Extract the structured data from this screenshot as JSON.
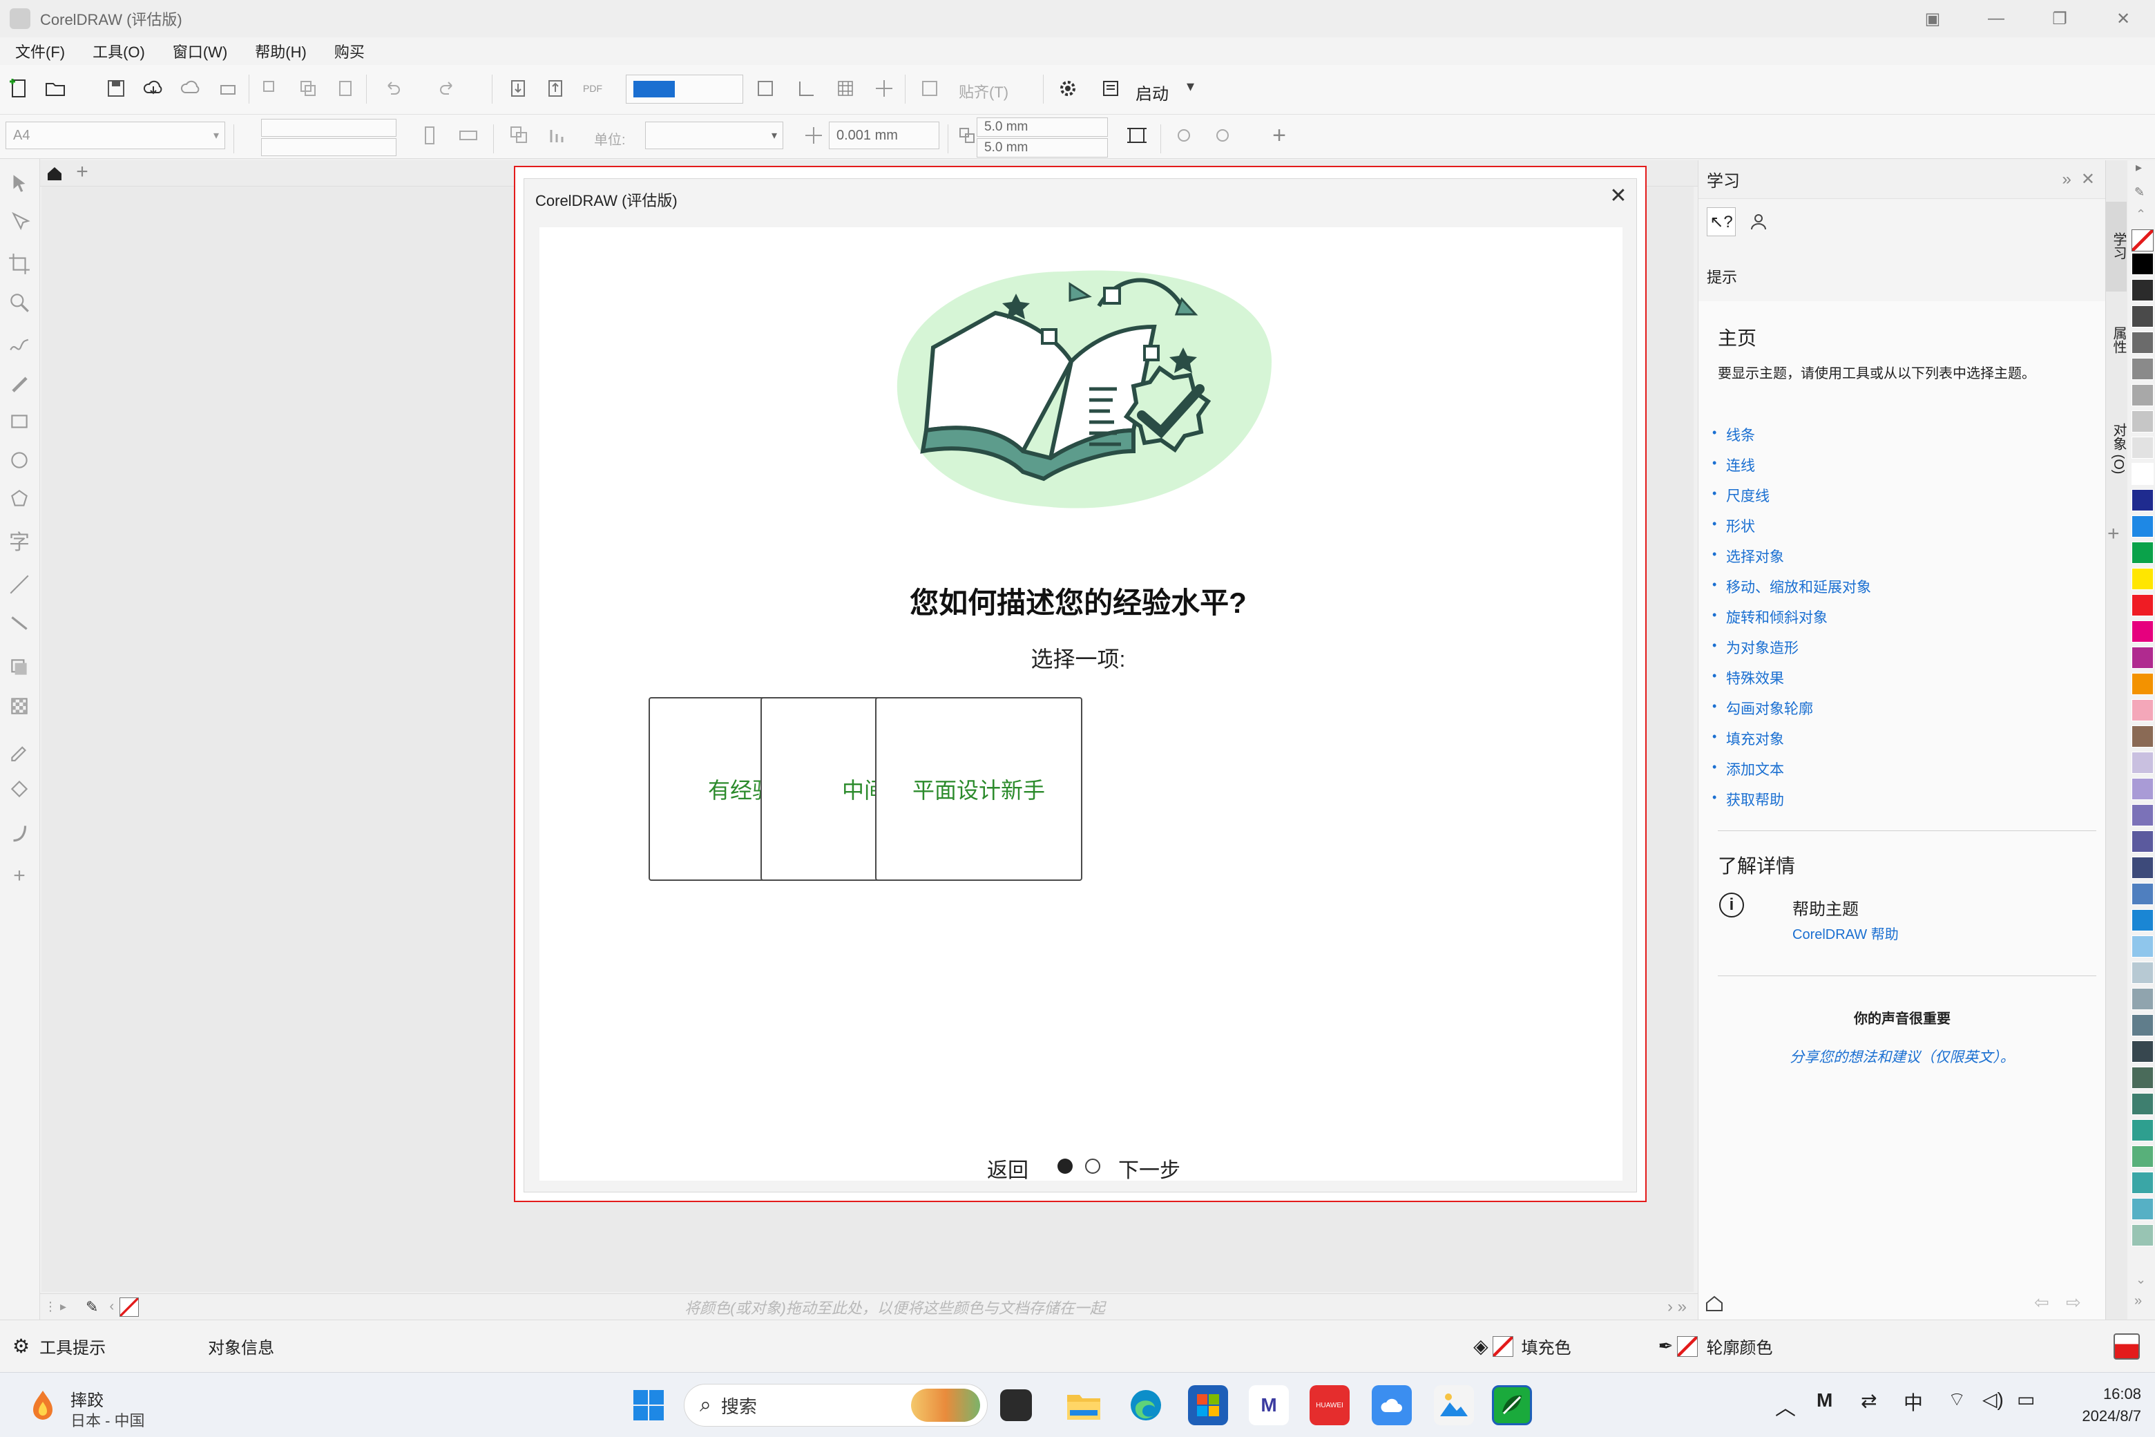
{
  "window": {
    "title": "CorelDRAW (评估版)"
  },
  "menu": [
    "文件(F)",
    "工具(O)",
    "窗口(W)",
    "帮助(H)",
    "购买"
  ],
  "toolbar": {
    "zoom_value": "",
    "pdf_label": "PDF",
    "snap_label": "贴齐(T)",
    "launch_label": "启动"
  },
  "propbar": {
    "page_size": "A4",
    "units_label": "单位:",
    "nudge": "0.001 mm",
    "dup_x": "5.0 mm",
    "dup_y": "5.0 mm"
  },
  "canvas": {
    "palette_hint": "将颜色(或对象)拖动至此处，以便将这些颜色与文档存储在一起"
  },
  "status": {
    "tool_hint": "工具提示",
    "object_info": "对象信息",
    "fill_label": "填充色",
    "outline_label": "轮廓颜色"
  },
  "docker": {
    "title": "学习",
    "hint_label": "提示",
    "home_heading": "主页",
    "home_desc": "要显示主题，请使用工具或从以下列表中选择主题。",
    "topics": [
      "线条",
      "连线",
      "尺度线",
      "形状",
      "选择对象",
      "移动、缩放和延展对象",
      "旋转和倾斜对象",
      "为对象造形",
      "特殊效果",
      "勾画对象轮廓",
      "填充对象",
      "添加文本",
      "获取帮助"
    ],
    "learn_more": "了解详情",
    "help_topic": "帮助主题",
    "help_link": "CorelDRAW 帮助",
    "feedback_heading": "你的声音很重要",
    "feedback_link": "分享您的想法和建议（仅限英文）。"
  },
  "side_tabs": [
    "学习",
    "属性",
    "对象 (O)"
  ],
  "dialog": {
    "title": "CorelDRAW (评估版)",
    "question": "您如何描述您的经验水平?",
    "subtitle": "选择一项:",
    "options": [
      "有经验的",
      "中间",
      "平面设计新手"
    ],
    "back": "返回",
    "next": "下一步"
  },
  "taskbar": {
    "weather_title": "摔跤",
    "weather_sub": "日本 - 中国",
    "search_placeholder": "搜索",
    "ime": "中",
    "time": "16:08",
    "date": "2024/8/7"
  },
  "colors": {
    "accent": "#1a6fd1",
    "dialog_border": "#e31b1b",
    "option_text": "#2c8b2c"
  },
  "palette_swatches": [
    "#000000",
    "#2b2b2b",
    "#4a4a4a",
    "#6b6b6b",
    "#8a8a8a",
    "#a8a8a8",
    "#c6c6c6",
    "#e2e2e2",
    "#ffffff",
    "#1f2b8f",
    "#1e88e5",
    "#0aa24a",
    "#ffe600",
    "#ef1c24",
    "#e6007e",
    "#b02a8f",
    "#f39200",
    "#f4a7b9",
    "#8a6a55",
    "#c9c0e0",
    "#a99bd6",
    "#7b72b8",
    "#5b5a9e",
    "#3d4a7a",
    "#4f7fbf",
    "#1a86d4",
    "#8fc6ec",
    "#b7c9d3",
    "#90a4ae",
    "#607d8b",
    "#37474f",
    "#4a6b5a",
    "#3e7f6f",
    "#2e9f8f",
    "#58b07a",
    "#3aa6a6",
    "#56b0c5",
    "#98c4b3"
  ]
}
